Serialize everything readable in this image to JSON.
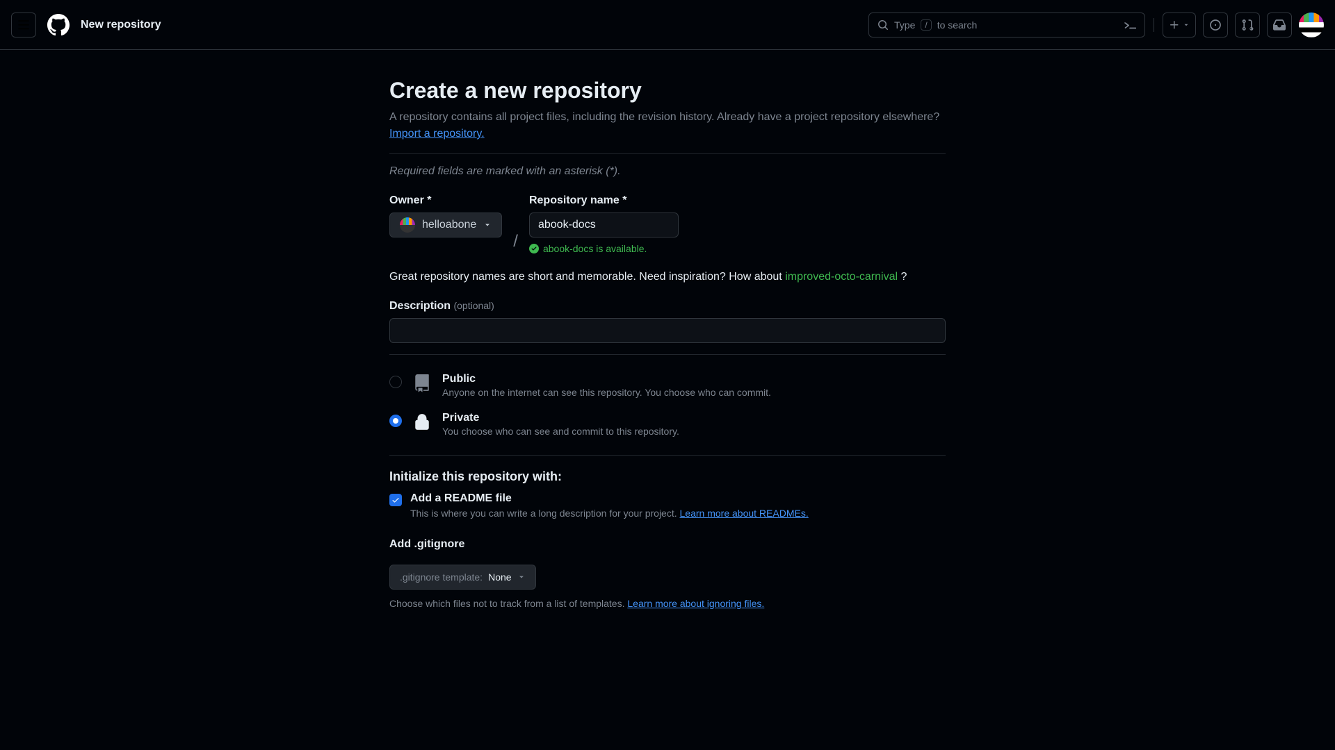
{
  "header": {
    "page_title": "New repository",
    "search_prefix": "Type",
    "search_key": "/",
    "search_suffix": "to search"
  },
  "main": {
    "heading": "Create a new repository",
    "subheading": "A repository contains all project files, including the revision history. Already have a project repository elsewhere?",
    "import_link": "Import a repository.",
    "required_note": "Required fields are marked with an asterisk (*).",
    "owner_label": "Owner *",
    "owner_value": "helloabone",
    "repo_label": "Repository name *",
    "repo_value": "abook-docs",
    "availability_msg": "abook-docs is available.",
    "inspire_prefix": "Great repository names are short and memorable. Need inspiration? How about ",
    "inspire_suggestion": "improved-octo-carnival",
    "inspire_suffix": " ?",
    "desc_label": "Description",
    "desc_optional": "(optional)",
    "visibility": {
      "public": {
        "title": "Public",
        "desc": "Anyone on the internet can see this repository. You choose who can commit."
      },
      "private": {
        "title": "Private",
        "desc": "You choose who can see and commit to this repository."
      }
    },
    "init": {
      "heading": "Initialize this repository with:",
      "readme_title": "Add a README file",
      "readme_desc": "This is where you can write a long description for your project. ",
      "readme_link": "Learn more about READMEs."
    },
    "gitignore": {
      "label": "Add .gitignore",
      "template_prefix": ".gitignore template:",
      "template_value": "None",
      "helper": "Choose which files not to track from a list of templates. ",
      "helper_link": "Learn more about ignoring files."
    }
  }
}
